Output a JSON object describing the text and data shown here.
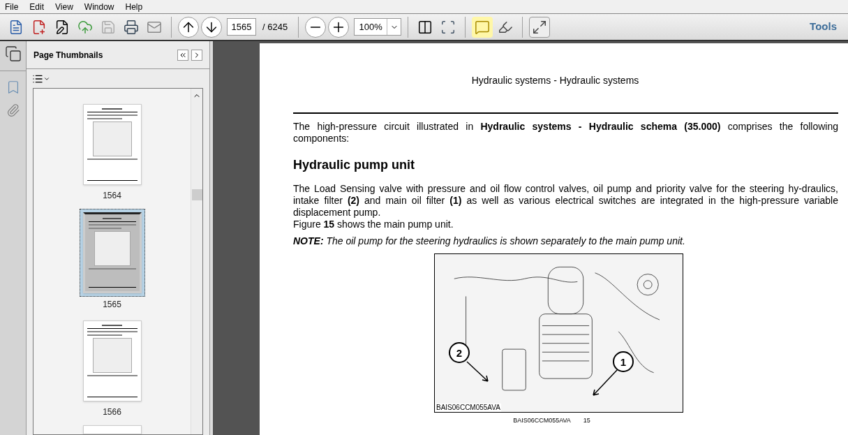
{
  "menu": [
    "File",
    "Edit",
    "View",
    "Window",
    "Help"
  ],
  "toolbar": {
    "page_field": "1565",
    "page_total": "/ 6245",
    "zoom_field": "100%",
    "tools_label": "Tools"
  },
  "thumbnails": {
    "title": "Page Thumbnails",
    "pages": [
      {
        "label": "1564",
        "selected": false
      },
      {
        "label": "1565",
        "selected": true
      },
      {
        "label": "1566",
        "selected": false
      }
    ]
  },
  "document": {
    "running_header": "Hydraulic systems - Hydraulic systems",
    "intro": "The high-pressure circuit illustrated in **Hydraulic systems - Hydraulic schema (35.000)** comprises the following components:",
    "heading": "Hydraulic pump unit",
    "body": "The Load Sensing valve with pressure and oil flow control valves, oil pump and priority valve for the steering hy-draulics, intake filter **(2)** and main oil filter **(1)** as well as various electrical switches are integrated in the high-pressure variable displacement pump.",
    "figure_ref": "Figure **15** shows the main pump unit.",
    "note": "**NOTE:** The oil pump for the steering hydraulics is shown separately to the main pump unit.",
    "figure": {
      "callouts": [
        "2",
        "1"
      ],
      "image_code": "BAIS06CCM055AVA",
      "caption_code": "BAIS06CCM055AVA",
      "caption_number": "15"
    }
  }
}
